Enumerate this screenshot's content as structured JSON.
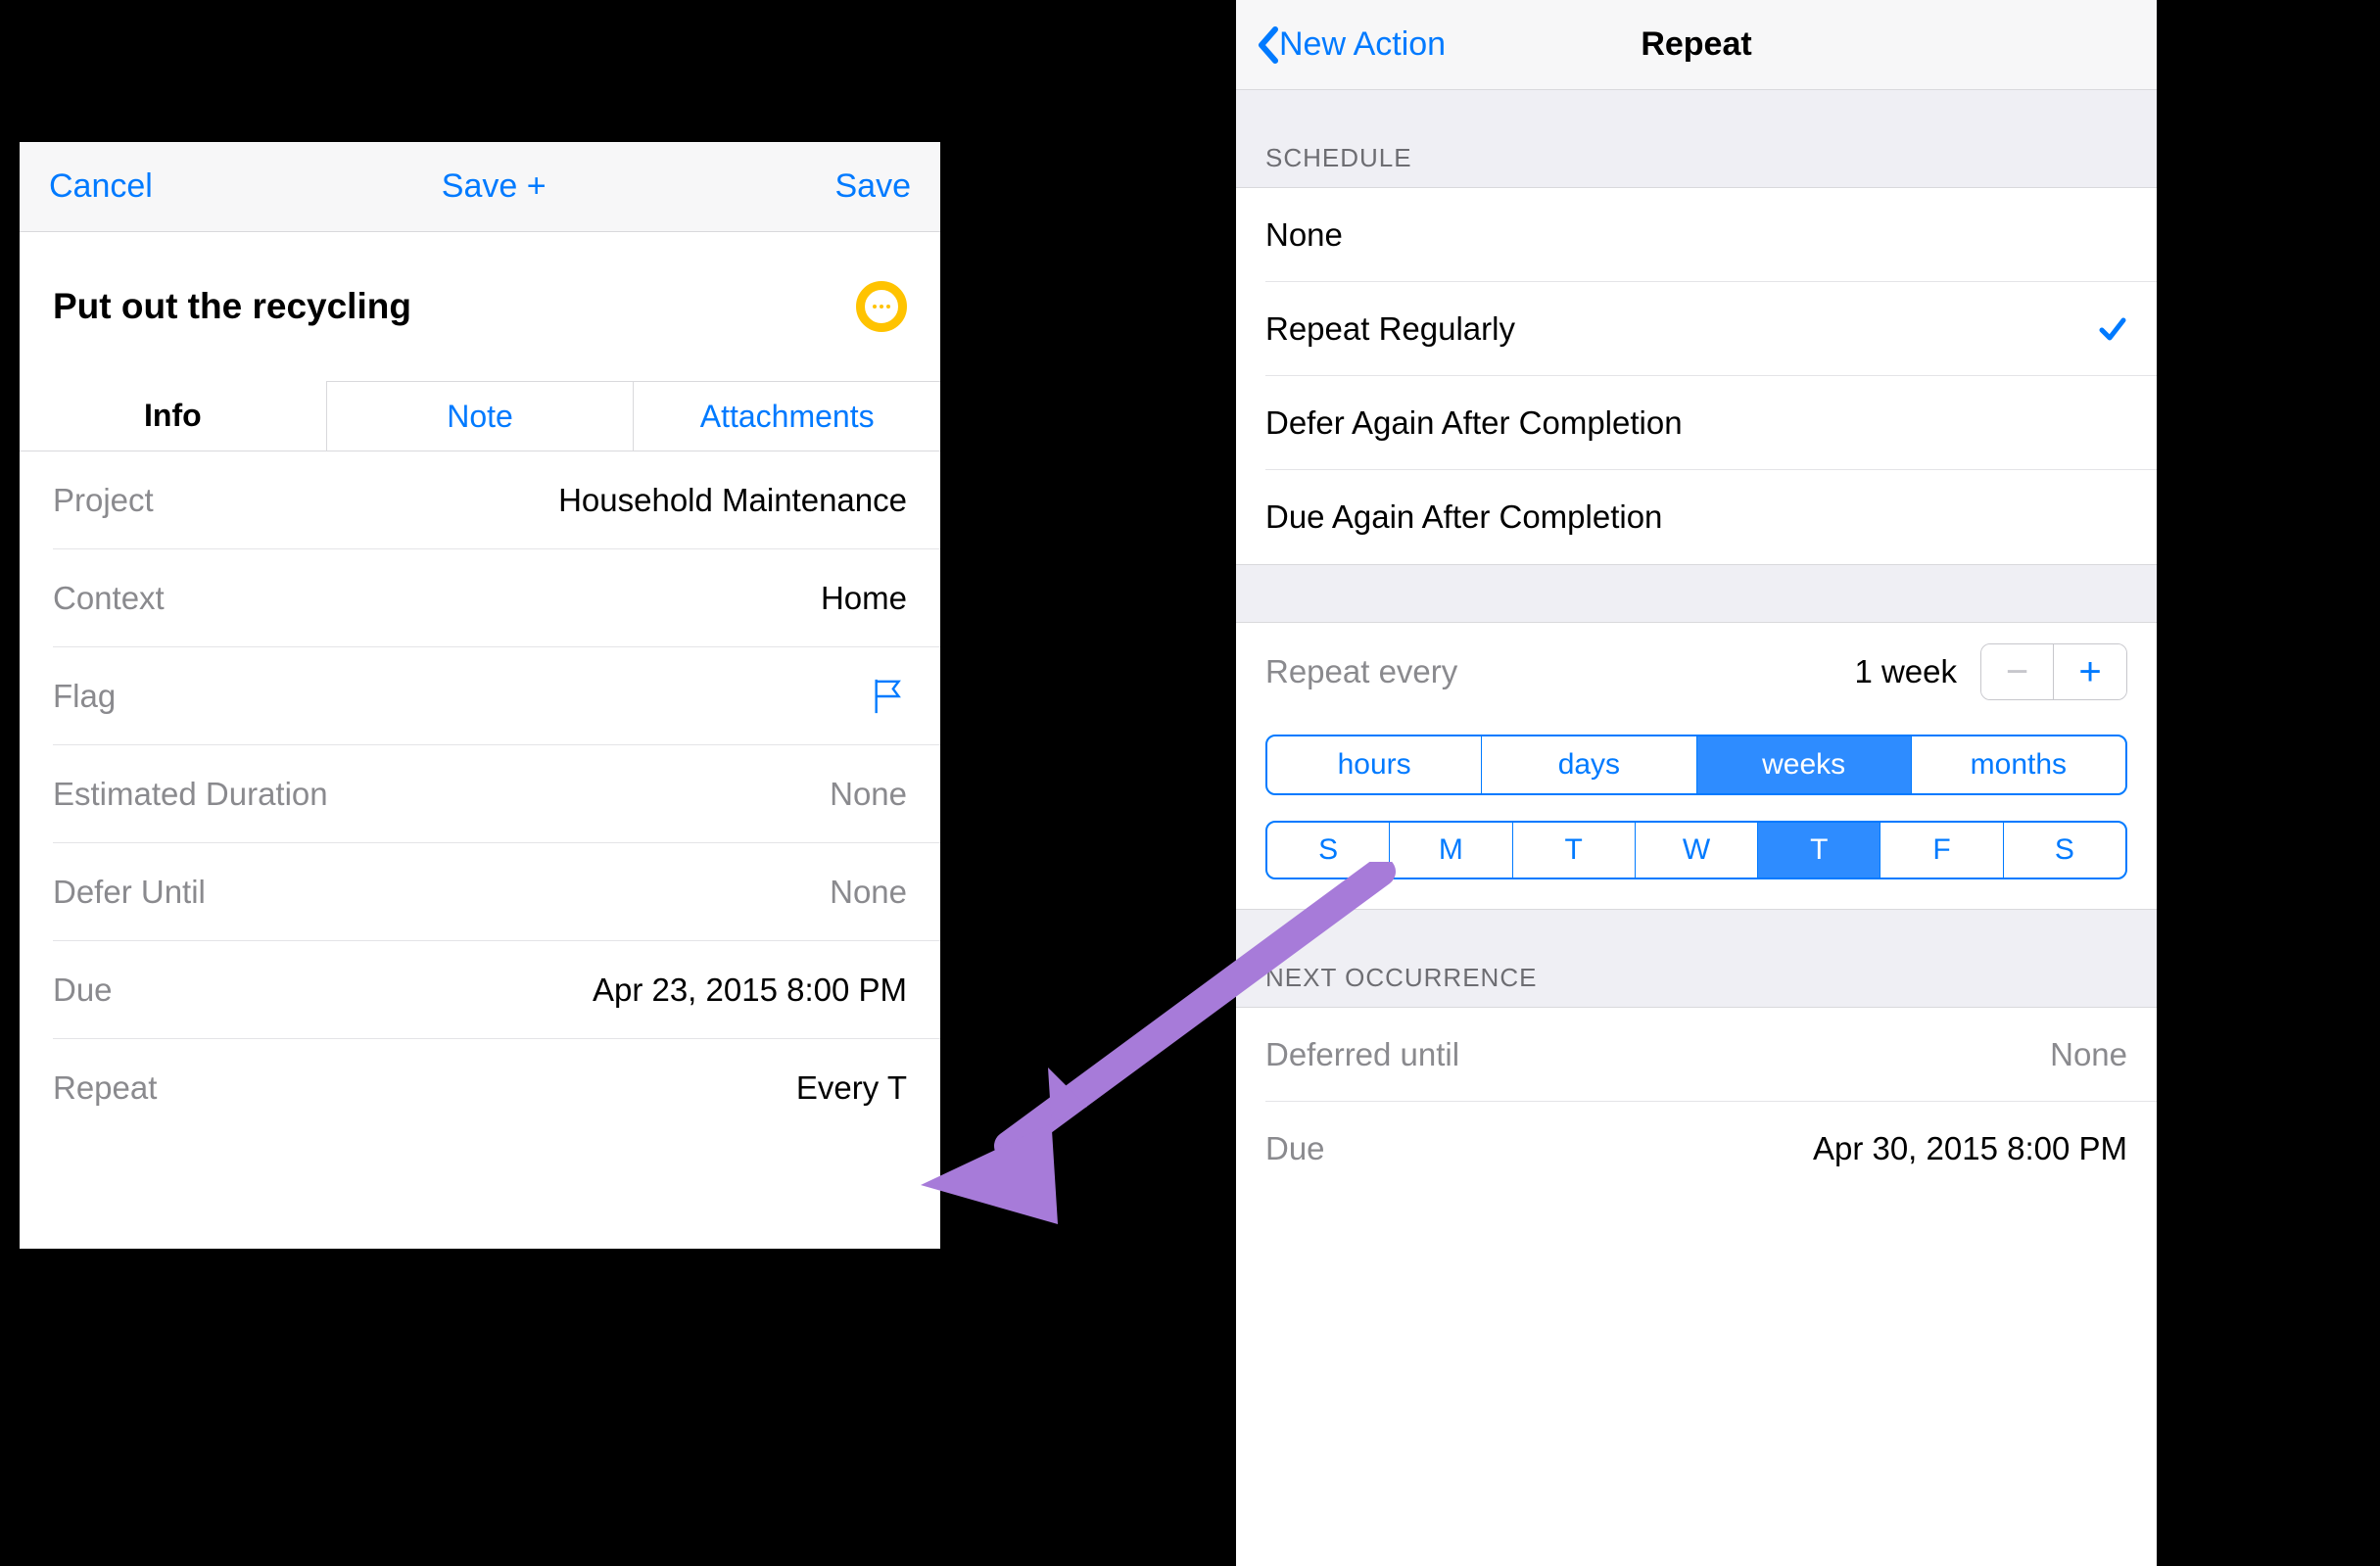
{
  "left": {
    "nav": {
      "cancel": "Cancel",
      "savePlus": "Save +",
      "save": "Save"
    },
    "title": "Put out the recycling",
    "tabs": {
      "info": "Info",
      "note": "Note",
      "attachments": "Attachments",
      "active": "info"
    },
    "rows": {
      "project": {
        "label": "Project",
        "value": "Household Maintenance"
      },
      "context": {
        "label": "Context",
        "value": "Home"
      },
      "flag": {
        "label": "Flag"
      },
      "duration": {
        "label": "Estimated Duration",
        "value": "None",
        "muted": true
      },
      "defer": {
        "label": "Defer Until",
        "value": "None",
        "muted": true
      },
      "due": {
        "label": "Due",
        "value": "Apr 23, 2015  8:00 PM"
      },
      "repeat": {
        "label": "Repeat",
        "value": "Every T"
      }
    }
  },
  "right": {
    "nav": {
      "back": "New Action",
      "title": "Repeat"
    },
    "scheduleHeader": "SCHEDULE",
    "scheduleOptions": [
      {
        "label": "None",
        "selected": false
      },
      {
        "label": "Repeat Regularly",
        "selected": true
      },
      {
        "label": "Defer Again After Completion",
        "selected": false
      },
      {
        "label": "Due Again After Completion",
        "selected": false
      }
    ],
    "repeatEvery": {
      "label": "Repeat every",
      "value": "1 week"
    },
    "units": [
      {
        "label": "hours",
        "selected": false
      },
      {
        "label": "days",
        "selected": false
      },
      {
        "label": "weeks",
        "selected": true
      },
      {
        "label": "months",
        "selected": false
      }
    ],
    "days": [
      {
        "label": "S",
        "selected": false
      },
      {
        "label": "M",
        "selected": false
      },
      {
        "label": "T",
        "selected": false
      },
      {
        "label": "W",
        "selected": false
      },
      {
        "label": "T",
        "selected": true
      },
      {
        "label": "F",
        "selected": false
      },
      {
        "label": "S",
        "selected": false
      }
    ],
    "nextHeader": "NEXT OCCURRENCE",
    "next": {
      "deferred": {
        "label": "Deferred until",
        "value": "None",
        "muted": true
      },
      "due": {
        "label": "Due",
        "value": "Apr 30, 2015  8:00 PM"
      }
    }
  },
  "colors": {
    "tint": "#007aff",
    "accent": "#ffc300",
    "arrow": "#a77bd9"
  }
}
